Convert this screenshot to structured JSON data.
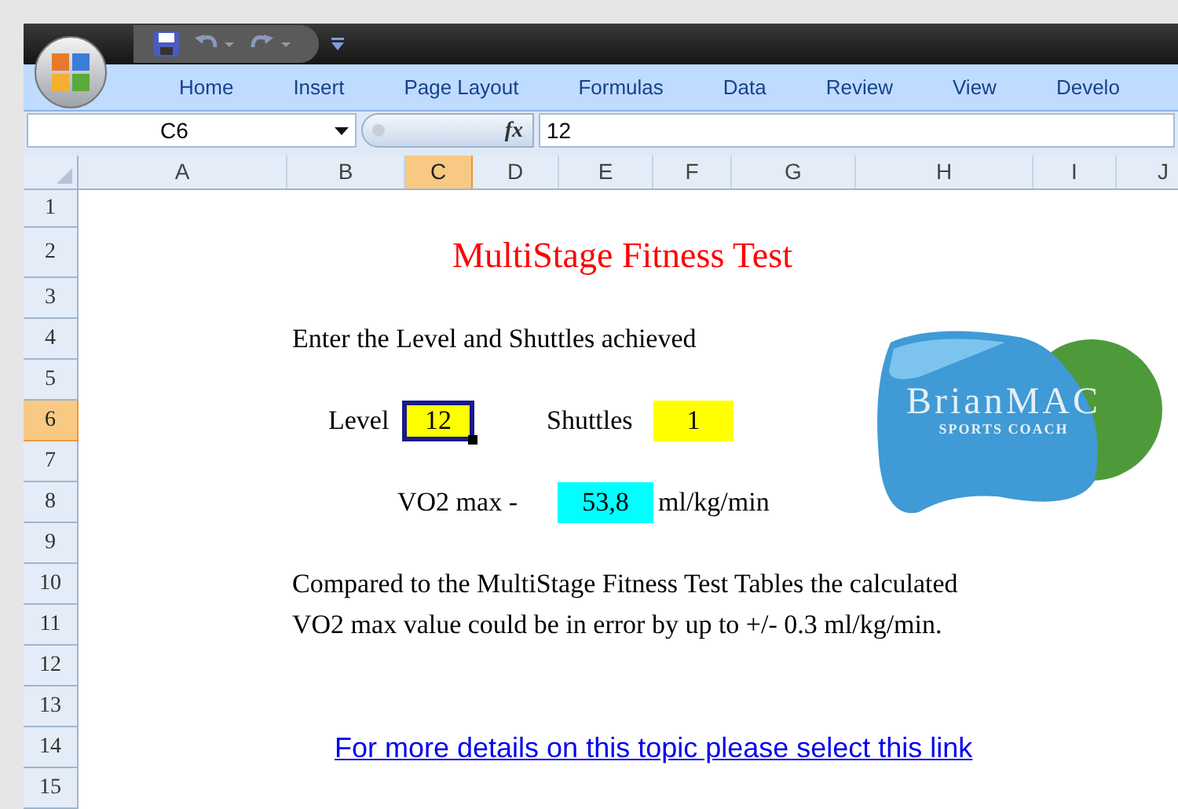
{
  "ribbon_tabs": [
    {
      "label": "Home",
      "selected": false
    },
    {
      "label": "Insert",
      "selected": false
    },
    {
      "label": "Page Layout",
      "selected": false
    },
    {
      "label": "Formulas",
      "selected": false
    },
    {
      "label": "Data",
      "selected": false
    },
    {
      "label": "Review",
      "selected": false
    },
    {
      "label": "View",
      "selected": false
    },
    {
      "label": "Develo",
      "selected": false
    }
  ],
  "name_box": "C6",
  "formula_bar": {
    "fx": "fx",
    "value": "12"
  },
  "columns": [
    {
      "label": "A",
      "selected": false
    },
    {
      "label": "B",
      "selected": false
    },
    {
      "label": "C",
      "selected": true
    },
    {
      "label": "D",
      "selected": false
    },
    {
      "label": "E",
      "selected": false
    },
    {
      "label": "F",
      "selected": false
    },
    {
      "label": "G",
      "selected": false
    },
    {
      "label": "H",
      "selected": false
    },
    {
      "label": "I",
      "selected": false
    },
    {
      "label": "J",
      "selected": false
    }
  ],
  "rows": [
    {
      "label": "1",
      "selected": false
    },
    {
      "label": "2",
      "selected": false
    },
    {
      "label": "3",
      "selected": false
    },
    {
      "label": "4",
      "selected": false
    },
    {
      "label": "5",
      "selected": false
    },
    {
      "label": "6",
      "selected": true
    },
    {
      "label": "7",
      "selected": false
    },
    {
      "label": "8",
      "selected": false
    },
    {
      "label": "9",
      "selected": false
    },
    {
      "label": "10",
      "selected": false
    },
    {
      "label": "11",
      "selected": false
    },
    {
      "label": "12",
      "selected": false
    },
    {
      "label": "13",
      "selected": false
    },
    {
      "label": "14",
      "selected": false
    },
    {
      "label": "15",
      "selected": false
    }
  ],
  "sheet": {
    "title": "MultiStage Fitness Test",
    "instruction": "Enter the Level and Shuttles achieved",
    "level_label": "Level",
    "level_value": "12",
    "shuttles_label": "Shuttles",
    "shuttles_value": "1",
    "vo2_label": "VO2 max -",
    "vo2_value": "53,8",
    "vo2_unit": "ml/kg/min",
    "note_lines": [
      "Compared to the MultiStage Fitness Test Tables the calculated",
      "VO2 max value could be in error by up to +/- 0.3 ml/kg/min."
    ],
    "link": "For more details on this topic please select this link"
  },
  "logo": {
    "name": "BrianMAC",
    "tagline": "SPORTS COACH"
  }
}
